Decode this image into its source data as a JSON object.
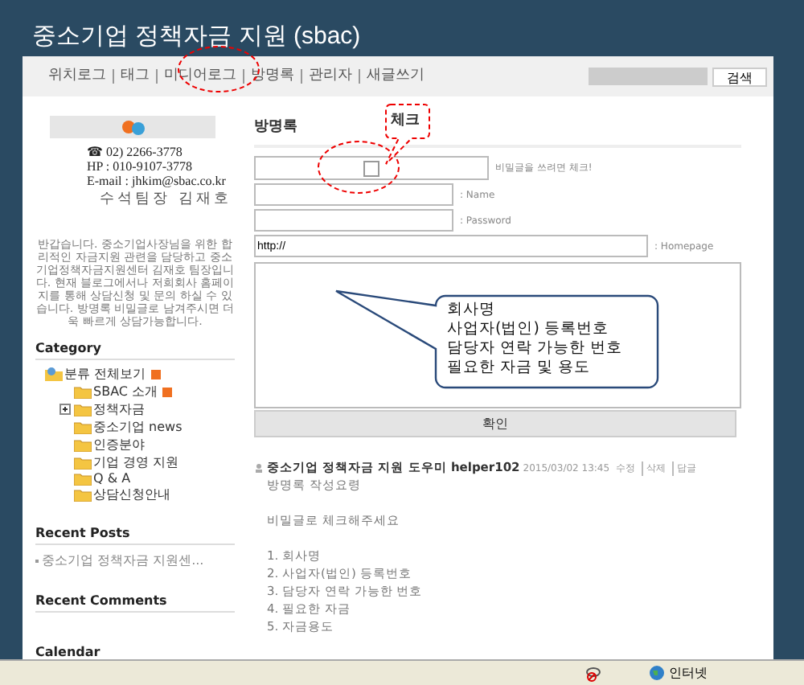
{
  "blog_title": "중소기업 정책자금 지원 (sbac)",
  "nav": {
    "links": [
      {
        "label": "위치로그"
      },
      {
        "label": "태그"
      },
      {
        "label": "미디어로그"
      },
      {
        "label": "방명록"
      },
      {
        "label": "관리자"
      },
      {
        "label": "새글쓰기"
      }
    ],
    "search_button": "검색"
  },
  "sidebar": {
    "contact": [
      "☎ 02) 2266-3778",
      "HP : 010-9107-3778",
      "E-mail : jhkim@sbac.co.kr"
    ],
    "contact_name": "수석팀장 김재호",
    "intro": "반갑습니다. 중소기업사장님을 위한 합리적인 자금지원 관련을 담당하고 중소기업정책자금지원센터 김재호 팀장입니다. 현재 블로그에서나 저희회사 홈페이지를 통해 상담신청 및 문의 하실 수 있습니다. 방명록 비밀글로 남겨주시면 더욱 빠르게 상담가능합니다.",
    "category_title": "Category",
    "categories": {
      "label": "분류 전체보기",
      "rss": true,
      "children": [
        {
          "label": "SBAC 소개",
          "rss": true
        },
        {
          "label": "정책자금",
          "rss": false,
          "expanded": false
        },
        {
          "label": "중소기업 news",
          "rss": false
        },
        {
          "label": "인증분야",
          "rss": false
        },
        {
          "label": "기업 경영 지원",
          "rss": false
        },
        {
          "label": "Q & A",
          "rss": false
        },
        {
          "label": "상담신청안내",
          "rss": false
        }
      ]
    },
    "recent_posts_title": "Recent Posts",
    "recent_posts": [
      "중소기업 정책자금 지원센..."
    ],
    "recent_comments_title": "Recent Comments",
    "calendar_title": "Calendar"
  },
  "guestbook": {
    "title": "방명록",
    "secret": {
      "checked": false,
      "label": "비밀글을 쓰려면 체크!"
    },
    "fields": [
      {
        "label": ": Name"
      },
      {
        "label": ": Password"
      },
      {
        "label": ": Homepage",
        "value": "http://"
      }
    ],
    "submit": "확인",
    "entry": {
      "author": "중소기업 정책자금 지원 도우미 helper102",
      "date": "2015/03/02 13:45",
      "actions": [
        "수정",
        "삭제",
        "답글"
      ],
      "paragraphs": [
        [
          "방명록 작성요령"
        ],
        [
          "비밀글로 체크해주세요"
        ],
        [
          "1. 회사명",
          "2. 사업자(법인) 등록번호",
          "3. 담당자 연락 가능한 번호",
          "4. 필요한 자금",
          "5. 자금용도"
        ]
      ]
    }
  },
  "annotations": {
    "check_callout": "체크",
    "info_callout": [
      "회사명",
      "사업자(법인) 등록번호",
      "담당자 연락 가능한 번호",
      "필요한 자금 및 용도"
    ]
  },
  "status_bar": {
    "zone": "인터넷"
  }
}
